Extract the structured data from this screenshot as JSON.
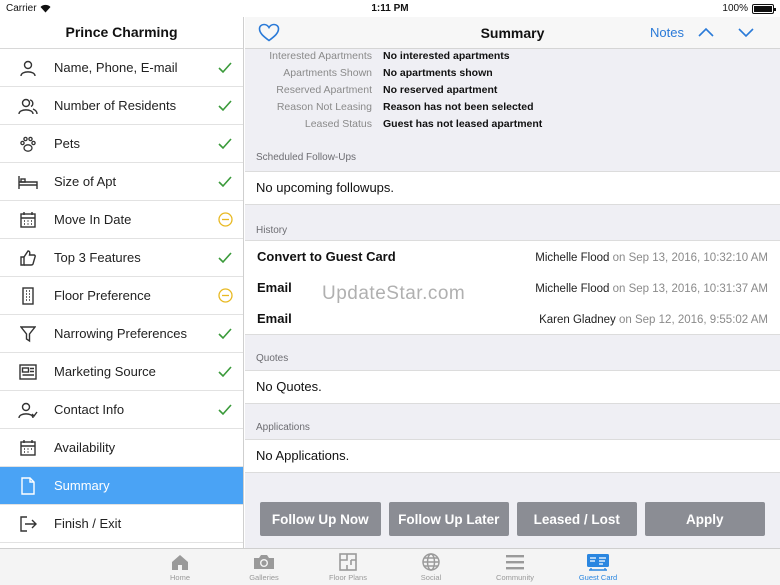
{
  "status_bar": {
    "carrier": "Carrier",
    "time": "1:11 PM",
    "battery": "100%"
  },
  "sidebar": {
    "title": "Prince Charming",
    "items": [
      {
        "label": "Name, Phone, E-mail",
        "icon": "user-icon",
        "status": "check"
      },
      {
        "label": "Number of Residents",
        "icon": "users-icon",
        "status": "check"
      },
      {
        "label": "Pets",
        "icon": "paw-icon",
        "status": "check"
      },
      {
        "label": "Size of Apt",
        "icon": "bed-icon",
        "status": "check"
      },
      {
        "label": "Move In Date",
        "icon": "calendar-icon",
        "status": "pending"
      },
      {
        "label": "Top 3 Features",
        "icon": "thumbs-up-icon",
        "status": "check"
      },
      {
        "label": "Floor Preference",
        "icon": "building-icon",
        "status": "pending"
      },
      {
        "label": "Narrowing Preferences",
        "icon": "filter-icon",
        "status": "check"
      },
      {
        "label": "Marketing Source",
        "icon": "newspaper-icon",
        "status": "check"
      },
      {
        "label": "Contact Info",
        "icon": "contact-icon",
        "status": "check"
      },
      {
        "label": "Availability",
        "icon": "calendar-grid-icon",
        "status": "none"
      },
      {
        "label": "Summary",
        "icon": "document-icon",
        "status": "none"
      },
      {
        "label": "Finish / Exit",
        "icon": "exit-icon",
        "status": "none"
      }
    ]
  },
  "navbar": {
    "title": "Summary",
    "notes": "Notes"
  },
  "properties": [
    {
      "key": "Interested Apartments",
      "value": "No interested apartments"
    },
    {
      "key": "Apartments Shown",
      "value": "No apartments shown"
    },
    {
      "key": "Reserved Apartment",
      "value": "No reserved apartment"
    },
    {
      "key": "Reason Not Leasing",
      "value": "Reason has not been selected"
    },
    {
      "key": "Leased Status",
      "value": "Guest has not leased apartment"
    }
  ],
  "followups": {
    "header": "Scheduled Follow-Ups",
    "text": "No upcoming followups."
  },
  "history": {
    "header": "History",
    "rows": [
      {
        "action": "Convert to Guest Card",
        "who": "Michelle Flood",
        "when": " on Sep 13, 2016, 10:32:10 AM"
      },
      {
        "action": "Email",
        "who": "Michelle Flood",
        "when": " on Sep 13, 2016, 10:31:37 AM"
      },
      {
        "action": "Email",
        "who": "Karen Gladney",
        "when": " on Sep 12, 2016, 9:55:02 AM"
      }
    ]
  },
  "quotes": {
    "header": "Quotes",
    "text": "No Quotes."
  },
  "applications": {
    "header": "Applications",
    "text": "No Applications."
  },
  "actions": {
    "follow_up_now": "Follow Up Now",
    "follow_up_later": "Follow Up Later",
    "leased_lost": "Leased / Lost",
    "apply": "Apply"
  },
  "watermark": "UpdateStar.com",
  "tabbar": {
    "tabs": [
      {
        "label": "Home",
        "icon": "home-icon"
      },
      {
        "label": "Galleries",
        "icon": "camera-icon"
      },
      {
        "label": "Floor Plans",
        "icon": "floor-plan-icon"
      },
      {
        "label": "Social",
        "icon": "globe-icon"
      },
      {
        "label": "Community",
        "icon": "menu-icon"
      },
      {
        "label": "Guest Card",
        "icon": "guest-card-icon"
      }
    ]
  },
  "colors": {
    "accent": "#4aa3f5",
    "check": "#3a9a3a",
    "pending": "#e8b923",
    "button": "#8b8d94",
    "link": "#2a7ad8"
  }
}
